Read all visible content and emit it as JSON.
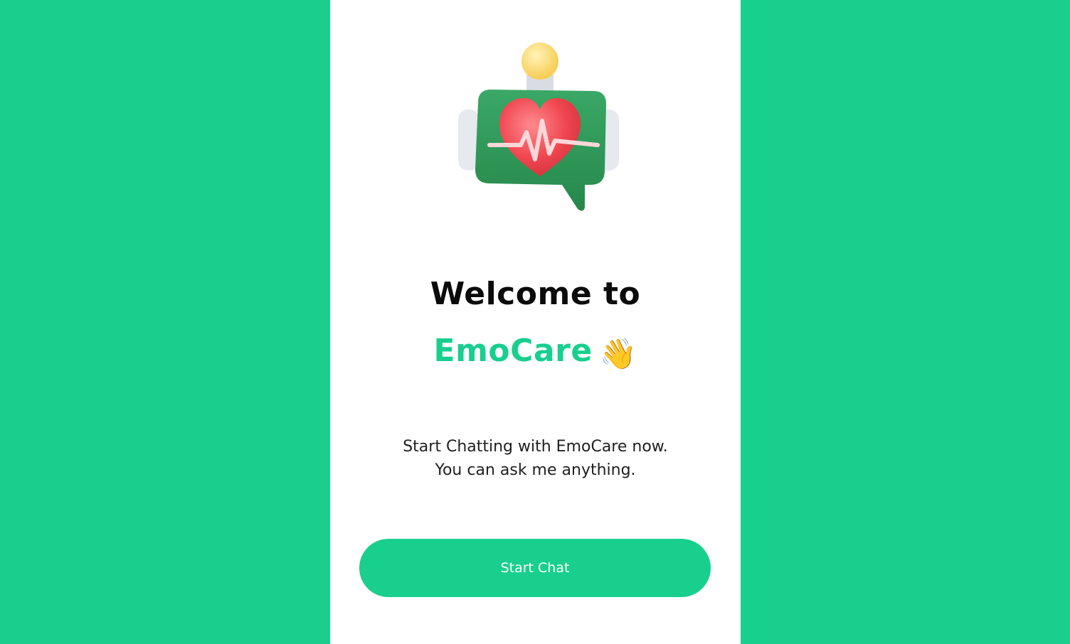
{
  "welcome": {
    "line1": "Welcome to",
    "app_name": "EmoCare",
    "wave_emoji": "👋",
    "subtitle_line1": "Start Chatting with EmoCare now.",
    "subtitle_line2": "You can ask me anything."
  },
  "actions": {
    "start_chat_label": "Start Chat"
  },
  "illustration": {
    "icon": "heart-chat-bubble-icon"
  },
  "colors": {
    "accent": "#18cf8e",
    "heart": "#f04650",
    "bubble": "#2e9e5a",
    "bulb": "#ffd86a",
    "text": "#0b0b0b"
  }
}
